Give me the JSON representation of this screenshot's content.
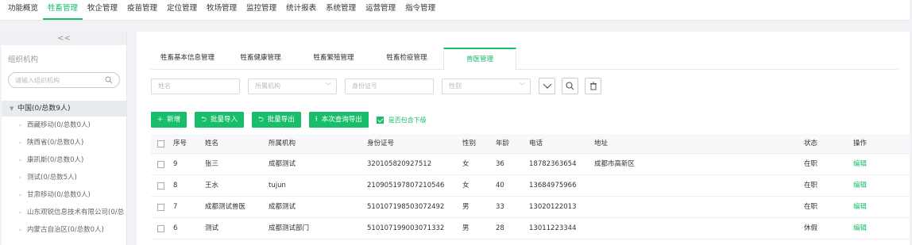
{
  "topnav": [
    "功能概览",
    "牲畜管理",
    "牧企管理",
    "疫苗管理",
    "定位管理",
    "牧场管理",
    "监控管理",
    "统计报表",
    "系统管理",
    "运营管理",
    "指令管理"
  ],
  "sidebar": {
    "collapse": "<<",
    "title": "组织机构",
    "search_placeholder": "请输入组织机构",
    "root": "中国(0/总数9人)",
    "items": [
      "西藏移动(0/总数0人)",
      "陕西省(0/总数0人)",
      "康凯斯(0/总数0人)",
      "测试(0/总数5人)",
      "甘肃移动(0/总数0人)",
      "山东观锐信息技术有限公司(0/总",
      "内蒙古自治区(0/总数0人)"
    ]
  },
  "tabs": [
    "牲畜基本信息管理",
    "牲畜健康管理",
    "牲畜繁殖管理",
    "牲畜检疫管理",
    "兽医管理"
  ],
  "filters": {
    "name": "姓名",
    "org": "所属机构",
    "idcard": "身份证号",
    "gender": "性别"
  },
  "actions": {
    "add": "新增",
    "import": "批量导入",
    "export": "批量导出",
    "export_query": "本次查询导出",
    "include_sub": "是否包含下级"
  },
  "table": {
    "headers": [
      "序号",
      "姓名",
      "所属机构",
      "身份证号",
      "性别",
      "年龄",
      "电话",
      "地址",
      "状态",
      "操作"
    ],
    "rows": [
      [
        "9",
        "张三",
        "成都测试",
        "320105820927512",
        "女",
        "36",
        "18782363654",
        "成都市高新区",
        "在职",
        "编辑"
      ],
      [
        "8",
        "王水",
        "tujun",
        "210905197807210546",
        "女",
        "40",
        "13684975966",
        "",
        "在职",
        "编辑"
      ],
      [
        "7",
        "成都测试兽医",
        "成都测试",
        "510107198503072492",
        "男",
        "33",
        "13020122013",
        "",
        "在职",
        "编辑"
      ],
      [
        "6",
        "测试",
        "成都测试部门",
        "510107199003071332",
        "男",
        "28",
        "13011223344",
        "",
        "休假",
        "编辑"
      ]
    ]
  },
  "colors": {
    "accent": "#19be6b"
  }
}
